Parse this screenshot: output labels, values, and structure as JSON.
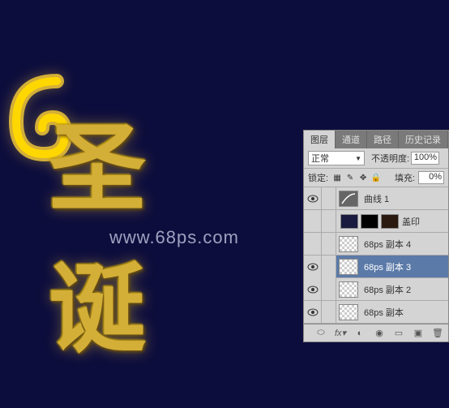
{
  "canvas": {
    "gold_text": "圣诞",
    "watermark": "www.68ps.com"
  },
  "panel": {
    "tabs": {
      "layers": "图层",
      "channels": "通道",
      "paths": "路径",
      "history": "历史记录"
    },
    "blend_mode": "正常",
    "opacity_label": "不透明度:",
    "opacity_value": "100%",
    "lock_label": "锁定:",
    "fill_label": "填充:",
    "fill_value": "0%",
    "layers": [
      {
        "name": "曲线 1",
        "visible": true,
        "type": "curves"
      },
      {
        "name": "盖印",
        "visible": false,
        "type": "multi"
      },
      {
        "name": "68ps 副本 4",
        "visible": false,
        "type": "normal"
      },
      {
        "name": "68ps 副本 3",
        "visible": true,
        "type": "normal",
        "selected": true
      },
      {
        "name": "68ps 副本 2",
        "visible": true,
        "type": "normal"
      },
      {
        "name": "68ps 副本",
        "visible": true,
        "type": "normal"
      }
    ]
  }
}
